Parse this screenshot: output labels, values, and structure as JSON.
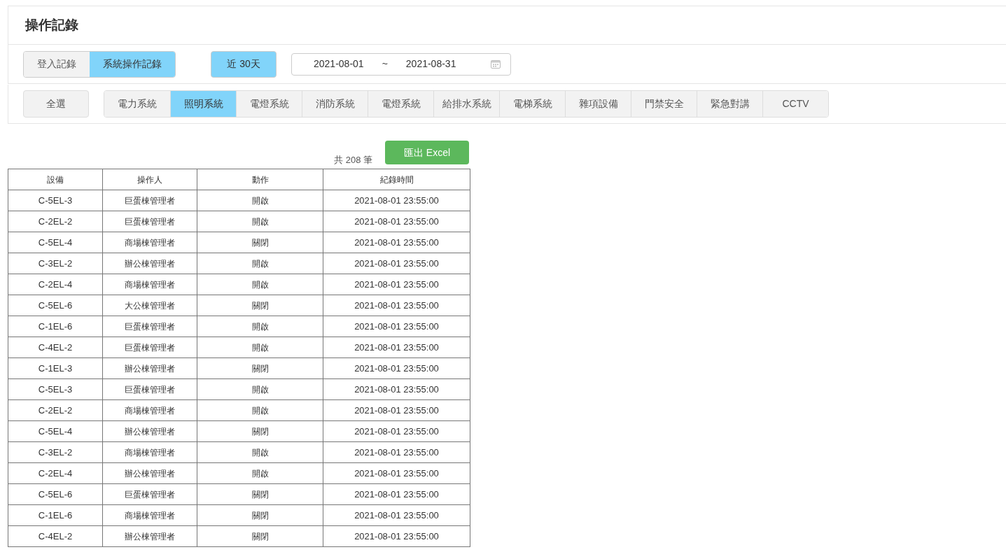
{
  "page_title": "操作記錄",
  "log_tabs": [
    {
      "label": "登入記錄",
      "selected": false
    },
    {
      "label": "系統操作記錄",
      "selected": true
    }
  ],
  "range_preset": {
    "label": "近 30天",
    "selected": true
  },
  "date_range": {
    "start": "2021-08-01",
    "separator": "~",
    "end": "2021-08-31"
  },
  "select_all": {
    "label": "全選",
    "selected": false
  },
  "categories": [
    {
      "label": "電力系統",
      "selected": false
    },
    {
      "label": "照明系統",
      "selected": true
    },
    {
      "label": "電燈系統",
      "selected": false
    },
    {
      "label": "消防系統",
      "selected": false
    },
    {
      "label": "電燈系統",
      "selected": false
    },
    {
      "label": "給排水系統",
      "selected": false
    },
    {
      "label": "電梯系統",
      "selected": false
    },
    {
      "label": "雜項設備",
      "selected": false
    },
    {
      "label": "門禁安全",
      "selected": false
    },
    {
      "label": "緊急對講",
      "selected": false
    },
    {
      "label": "CCTV",
      "selected": false
    }
  ],
  "record_count": "共 208 筆",
  "export_button": "匯出 Excel",
  "table": {
    "columns": [
      "設備",
      "操作人",
      "動作",
      "紀錄時間"
    ],
    "rows": [
      [
        "C-5EL-3",
        "巨蛋棟管理者",
        "開啟",
        "2021-08-01 23:55:00"
      ],
      [
        "C-2EL-2",
        "巨蛋棟管理者",
        "開啟",
        "2021-08-01 23:55:00"
      ],
      [
        "C-5EL-4",
        "商場棟管理者",
        "關閉",
        "2021-08-01 23:55:00"
      ],
      [
        "C-3EL-2",
        "辦公棟管理者",
        "開啟",
        "2021-08-01 23:55:00"
      ],
      [
        "C-2EL-4",
        "商場棟管理者",
        "開啟",
        "2021-08-01 23:55:00"
      ],
      [
        "C-5EL-6",
        "大公棟管理者",
        "關閉",
        "2021-08-01 23:55:00"
      ],
      [
        "C-1EL-6",
        "巨蛋棟管理者",
        "開啟",
        "2021-08-01 23:55:00"
      ],
      [
        "C-4EL-2",
        "巨蛋棟管理者",
        "開啟",
        "2021-08-01 23:55:00"
      ],
      [
        "C-1EL-3",
        "辦公棟管理者",
        "關閉",
        "2021-08-01 23:55:00"
      ],
      [
        "C-5EL-3",
        "巨蛋棟管理者",
        "開啟",
        "2021-08-01 23:55:00"
      ],
      [
        "C-2EL-2",
        "商場棟管理者",
        "開啟",
        "2021-08-01 23:55:00"
      ],
      [
        "C-5EL-4",
        "辦公棟管理者",
        "關閉",
        "2021-08-01 23:55:00"
      ],
      [
        "C-3EL-2",
        "商場棟管理者",
        "開啟",
        "2021-08-01 23:55:00"
      ],
      [
        "C-2EL-4",
        "辦公棟管理者",
        "開啟",
        "2021-08-01 23:55:00"
      ],
      [
        "C-5EL-6",
        "巨蛋棟管理者",
        "關閉",
        "2021-08-01 23:55:00"
      ],
      [
        "C-1EL-6",
        "商場棟管理者",
        "關閉",
        "2021-08-01 23:55:00"
      ],
      [
        "C-4EL-2",
        "辦公棟管理者",
        "關閉",
        "2021-08-01 23:55:00"
      ]
    ]
  }
}
